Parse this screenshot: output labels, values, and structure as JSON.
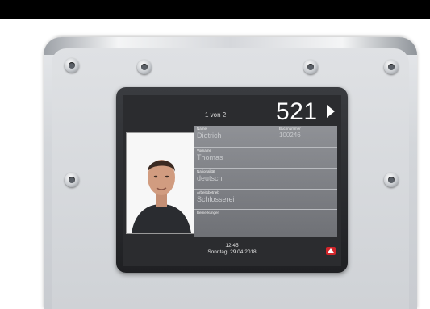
{
  "header": {
    "pager": "1 von 2",
    "number": "521"
  },
  "person": {
    "name_label": "Name",
    "name": "Dietrich",
    "buchnr_label": "Buchnummer",
    "buchnr": "100246",
    "vorname_label": "Vorname",
    "vorname": "Thomas",
    "nation_label": "Nationalität",
    "nation": "deutsch",
    "betrieb_label": "Arbeitsbetrieb",
    "betrieb": "Schlosserei",
    "bemerk_label": "Bemerkungen",
    "bemerk": ""
  },
  "footer": {
    "time": "12:45",
    "date": "Sonntag, 29.04.2018"
  },
  "colors": {
    "logo": "#d2262b",
    "lcd_bg": "#2b2c2f",
    "panel": "#7f8186"
  },
  "icons": {
    "next": "play-triangle-icon",
    "logo": "red-house-logo-icon"
  }
}
